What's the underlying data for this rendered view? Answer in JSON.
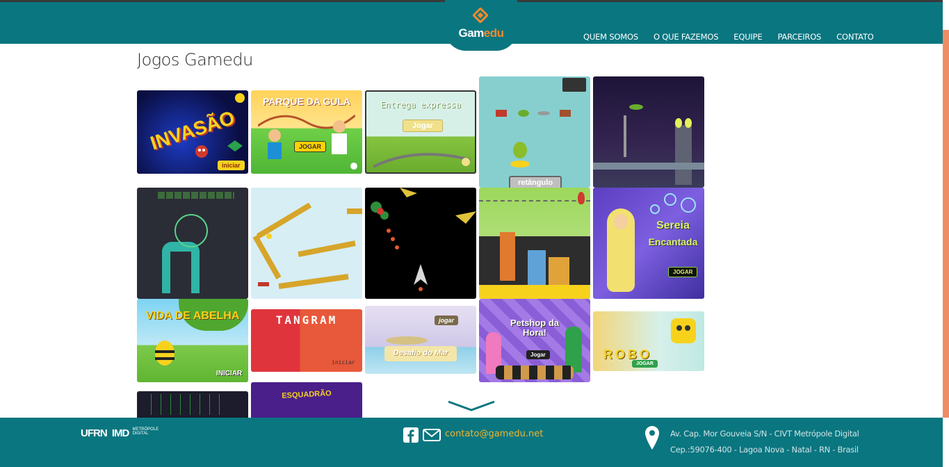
{
  "header": {
    "logo_text_main": "Gam",
    "logo_text_accent": "edu",
    "nav": [
      "QUEM SOMOS",
      "O QUE FAZEMOS",
      "EQUIPE",
      "PARCEIROS",
      "CONTATO"
    ]
  },
  "page": {
    "title": "Jogos Gamedu"
  },
  "games": {
    "invasao": {
      "title": "INVASÃO",
      "button": "iniciar"
    },
    "parque": {
      "title": "PARQUE DA GULA",
      "button": "JOGAR"
    },
    "entrega": {
      "title": "Entrega expressa",
      "button": "Jogar"
    },
    "retangulo": {
      "button": "retângulo"
    },
    "sereia": {
      "title_1": "Sereia",
      "title_2": "Encantada",
      "button": "JOGAR"
    },
    "abelha": {
      "title": "VIDA DE ABELHA",
      "button": "INICIAR"
    },
    "tangram": {
      "title": "TANGRAM",
      "button": "iniciar"
    },
    "desafio": {
      "title": "Desafio do Mar",
      "button": "jogar"
    },
    "petshop": {
      "title": "Petshop da Hora!",
      "button": "Jogar"
    },
    "robo": {
      "title": "ROBO",
      "button": "JOGAR"
    },
    "esquadrao": {
      "title": "ESQUADRÃO"
    }
  },
  "footer": {
    "logo_ufrn": "UFRN",
    "logo_imd": "IMD",
    "logo_imd_sub_1": "METRÓPOLE",
    "logo_imd_sub_2": "DIGITAL",
    "email": "contato@gamedu.net",
    "address_line1": "Av. Cap. Mor Gouveia S/N - CIVT Metrópole Digital",
    "address_line2": "Cep.:59076-400 - Lagoa Nova - Natal - RN - Brasil"
  },
  "colors": {
    "teal": "#0a7680",
    "orange": "#f18a2c",
    "email": "#f1b52d"
  }
}
